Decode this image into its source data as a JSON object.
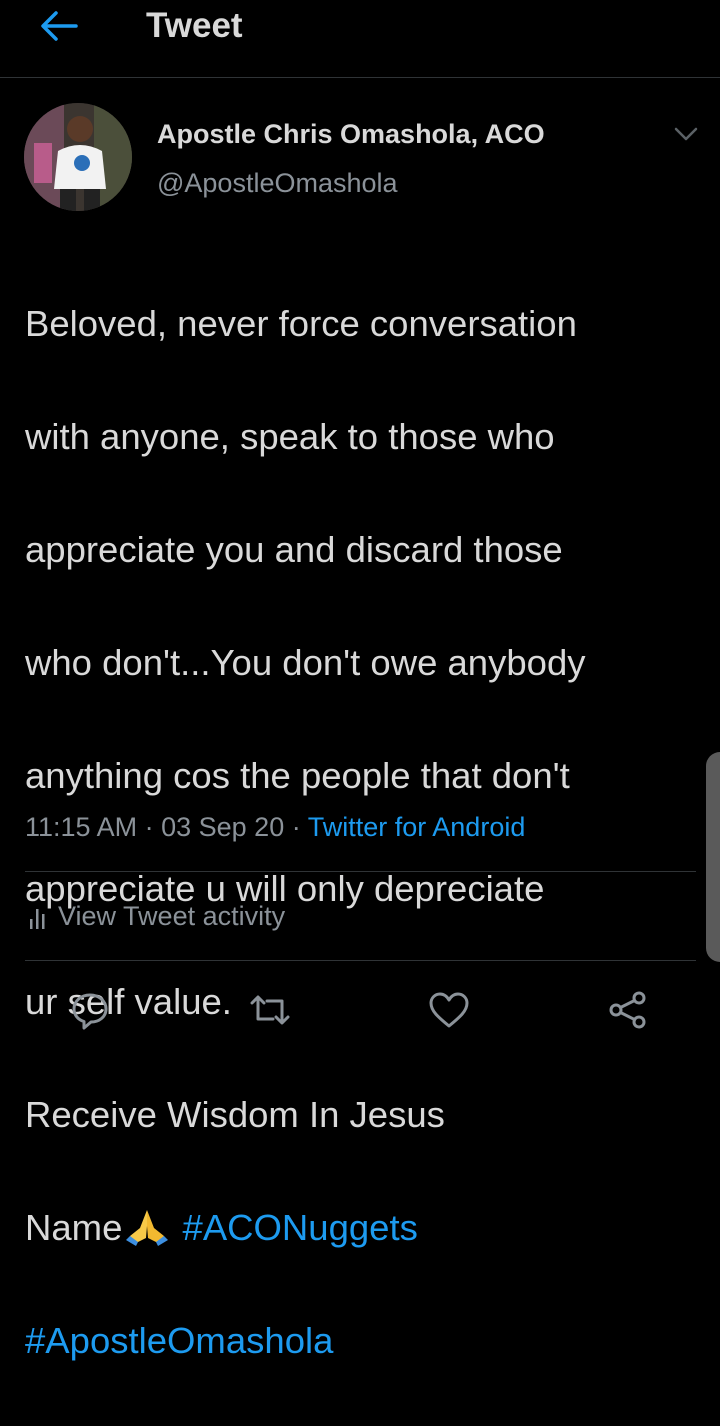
{
  "header": {
    "title": "Tweet",
    "back_icon": "back-arrow-icon",
    "accent": "#1d9bf0"
  },
  "tweet": {
    "author_name": "Apostle Chris Omashola, ACO",
    "author_handle": "@ApostleOmashola",
    "text_lines": [
      "Beloved, never force conversation",
      "with anyone, speak to those who",
      "appreciate you and discard those",
      "who don't...You don't owe anybody",
      "anything cos the people that don't",
      "appreciate u will only depreciate",
      "ur self value.",
      "Receive Wisdom In Jesus",
      "Name"
    ],
    "emoji": "folded-hands",
    "hashtags": [
      "#ACONuggets",
      "#ApostleOmashola"
    ],
    "time": "11:15 AM",
    "date": "03 Sep 20",
    "source": "Twitter for Android",
    "separator": "·"
  },
  "activity": {
    "label": "View Tweet activity",
    "icon": "bar-chart-icon"
  },
  "actions": [
    {
      "name": "reply",
      "icon": "reply-icon"
    },
    {
      "name": "retweet",
      "icon": "retweet-icon"
    },
    {
      "name": "like",
      "icon": "heart-icon"
    },
    {
      "name": "share",
      "icon": "share-icon"
    }
  ],
  "colors": {
    "background": "#000000",
    "text": "#d9d9d9",
    "secondary": "#8b9299",
    "link": "#1d9bf0",
    "divider": "#2f3336"
  }
}
